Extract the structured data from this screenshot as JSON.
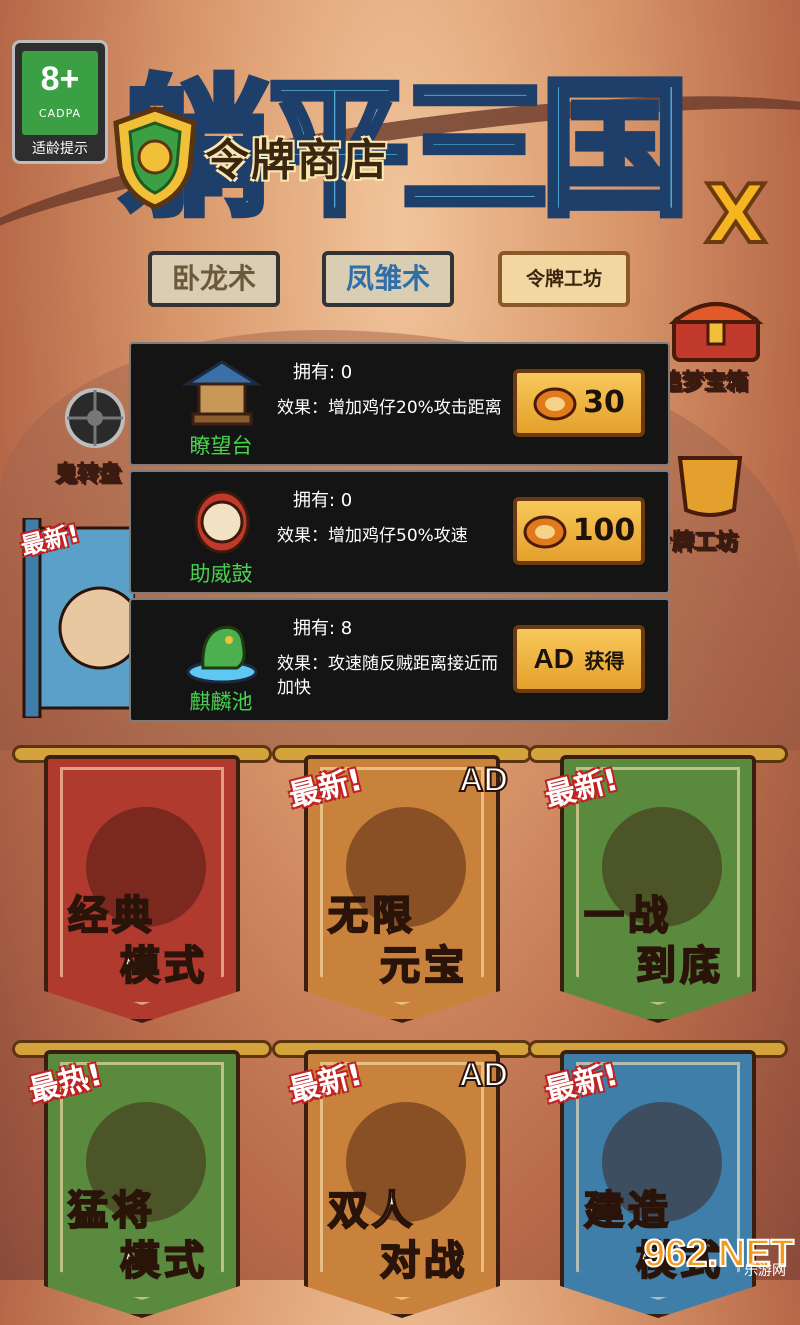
{
  "age_rating": {
    "number": "8+",
    "org": "CADPA",
    "label": "适龄提示"
  },
  "logo": {
    "title": "躺平三国",
    "badge": "X"
  },
  "shop": {
    "title": "令牌商店"
  },
  "tabs": [
    {
      "label": "卧龙术"
    },
    {
      "label": "凤雏术"
    },
    {
      "label": "令牌工坊"
    }
  ],
  "side": {
    "chest_label": "追梦宝箱",
    "wheel_label": "鬼转盘",
    "workshop_label": "令牌工坊",
    "latest_tag": "最新!"
  },
  "items": [
    {
      "name": "瞭望台",
      "owned_label": "拥有: 0",
      "effect": "效果：增加鸡仔20%攻击距离",
      "price": "30"
    },
    {
      "name": "助威鼓",
      "owned_label": "拥有: 0",
      "effect": "效果：增加鸡仔50%攻速",
      "price": "100"
    },
    {
      "name": "麒麟池",
      "owned_label": "拥有: 8",
      "effect": "效果：攻速随反贼距离接近而加快",
      "ad_label": "AD",
      "get_label": "获得"
    }
  ],
  "modes": [
    {
      "line1": "经典",
      "line2": "模式",
      "tag": "",
      "ad": ""
    },
    {
      "line1": "无限",
      "line2": "元宝",
      "tag": "最新!",
      "ad": "AD"
    },
    {
      "line1": "一战",
      "line2": "到底",
      "tag": "最新!",
      "ad": ""
    },
    {
      "line1": "猛将",
      "line2": "模式",
      "tag": "最热!",
      "ad": ""
    },
    {
      "line1": "双人",
      "line2": "对战",
      "tag": "最新!",
      "ad": "AD"
    },
    {
      "line1": "建造",
      "line2": "模式",
      "tag": "最新!",
      "ad": ""
    }
  ],
  "watermark": {
    "text": "962.NET",
    "sub": "乐游网"
  },
  "colors": {
    "item_name": "#48d14e",
    "button": "#f0b544",
    "panel": "#141414"
  }
}
